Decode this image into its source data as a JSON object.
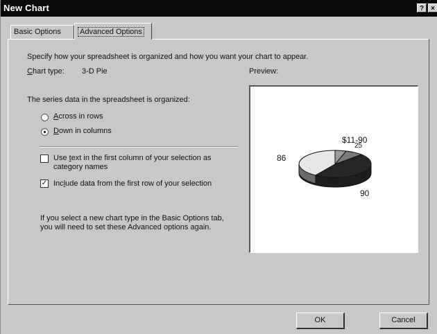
{
  "window": {
    "title": "New Chart",
    "help_glyph": "?",
    "close_glyph": "×"
  },
  "tabs": [
    {
      "label": "Basic Options",
      "active": false
    },
    {
      "label": "Advanced Options",
      "active": true
    }
  ],
  "content": {
    "instructions": "Specify how your spreadsheet is organized and how you want your chart to appear.",
    "chart_type_label": "Chart type:",
    "chart_type_value": "3-D Pie",
    "preview_label": "Preview:",
    "series_heading": "The series data in the spreadsheet is organized:",
    "radio_rows": {
      "label": "Across in rows",
      "selected": false
    },
    "radio_columns": {
      "label": "Down in columns",
      "selected": true
    },
    "checkbox_first_column": {
      "line1": "Use text in the first column of your selection as",
      "line2": "category names",
      "checked": false
    },
    "checkbox_first_row": {
      "label": "Include data from the first row of your selection",
      "checked": true
    },
    "note_line1": "If you select a new chart type in the Basic Options tab,",
    "note_line2": "you will need to set these Advanced options again."
  },
  "preview": {
    "labels": {
      "left": "86",
      "top": "$11-90",
      "top_overlap": "25",
      "bottom": "90"
    },
    "colors": {
      "slice_light": "#e6e6e6",
      "slice_dark": "#262626",
      "slice_mid": "#7a7a7a",
      "edge": "#111111"
    }
  },
  "buttons": {
    "ok": "OK",
    "cancel": "Cancel"
  }
}
